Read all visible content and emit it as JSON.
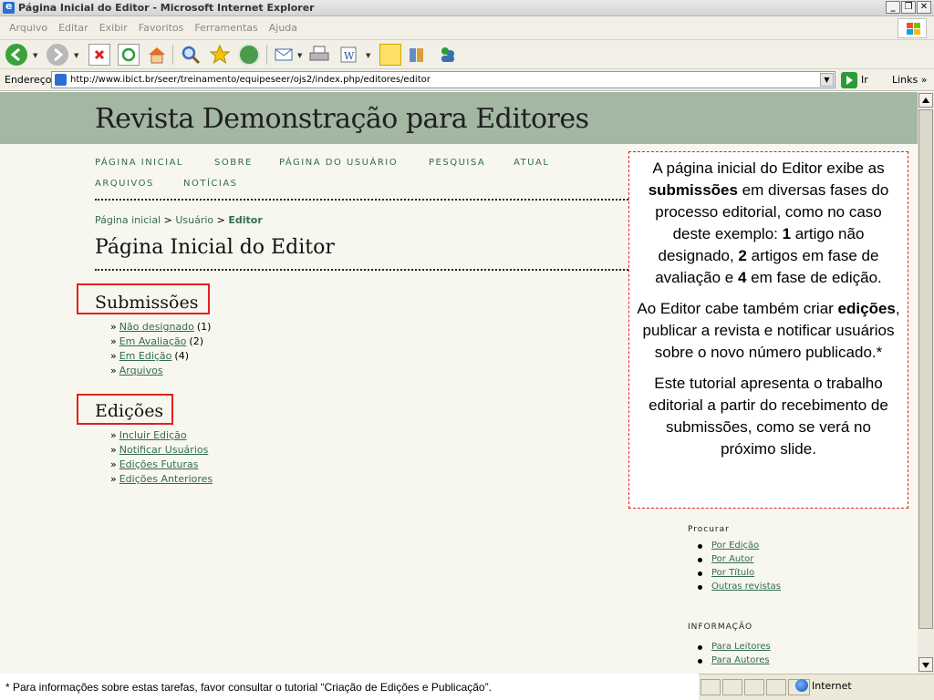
{
  "window": {
    "title": "Página Inicial do Editor - Microsoft Internet Explorer",
    "min_glyph": "_",
    "max_glyph": "❐",
    "close_glyph": "✕"
  },
  "menu": {
    "items": [
      "Arquivo",
      "Editar",
      "Exibir",
      "Favoritos",
      "Ferramentas",
      "Ajuda"
    ]
  },
  "toolbar": {
    "icons": [
      "back-icon",
      "forward-icon",
      "stop-icon",
      "refresh-icon",
      "home-icon",
      "search-icon",
      "favorites-icon",
      "history-icon",
      "mail-icon",
      "print-icon",
      "edit-icon",
      "notes-icon",
      "research-icon",
      "messenger-icon"
    ]
  },
  "address": {
    "label": "Endereço",
    "url": "http://www.ibict.br/seer/treinamento/equipeseer/ojs2/index.php/editores/editor",
    "go_label": "Ir",
    "links_label": "Links",
    "links_chevron": "»"
  },
  "site": {
    "title": "Revista Demonstração para Editores"
  },
  "nav": {
    "items": [
      "PÁGINA INICIAL",
      "SOBRE",
      "PÁGINA DO USUÁRIO",
      "PESQUISA",
      "ATUAL",
      "ARQUIVOS",
      "NOTÍCIAS"
    ]
  },
  "breadcrumb": {
    "home": "Página inicial",
    "separator": ">",
    "user": "Usuário",
    "current": "Editor"
  },
  "page": {
    "title": "Página Inicial do Editor"
  },
  "submissions": {
    "title": "Submissões",
    "items": [
      {
        "label": "Não designado",
        "count": "(1)"
      },
      {
        "label": "Em Avaliação",
        "count": "(2)"
      },
      {
        "label": "Em Edição",
        "count": "(4)"
      },
      {
        "label": "Arquivos",
        "count": ""
      }
    ]
  },
  "editions": {
    "title": "Edições",
    "items": [
      {
        "label": "Incluir Edição"
      },
      {
        "label": "Notificar Usuários"
      },
      {
        "label": "Edições Futuras"
      },
      {
        "label": "Edições Anteriores"
      }
    ]
  },
  "callout": {
    "p1_a": "A página inicial do Editor exibe as ",
    "p1_b": "submissões",
    "p1_c": " em diversas fases do processo editorial, como no caso deste exemplo: ",
    "p1_d": "1",
    "p1_e": " artigo não designado,  ",
    "p1_f": "2",
    "p1_g": " artigos em fase de avaliação e ",
    "p1_h": "4",
    "p1_i": " em fase de edição.",
    "p2_a": "Ao Editor cabe também criar ",
    "p2_b": "edições",
    "p2_c": ", publicar a revista e notificar usuários sobre o novo número publicado.*",
    "p3": "Este tutorial apresenta o trabalho editorial a partir do recebimento de submissões, como se verá no próximo slide."
  },
  "sidebar": {
    "browse_title": "Procurar",
    "browse_items": [
      "Por Edição",
      "Por Autor",
      "Por Título",
      "Outras revistas"
    ],
    "info_title": "INFORMAÇÃO",
    "info_items": [
      "Para Leitores",
      "Para Autores"
    ]
  },
  "footnote": "* Para informações sobre estas tarefas, favor consultar o tutorial “Criação de Edições e Publicação”.",
  "status": {
    "zone": "Internet"
  },
  "colors": {
    "header_bg": "#a3b7a3",
    "page_bg": "#f7f7ef",
    "link": "#346b52",
    "highlight_red": "#e3201c"
  }
}
